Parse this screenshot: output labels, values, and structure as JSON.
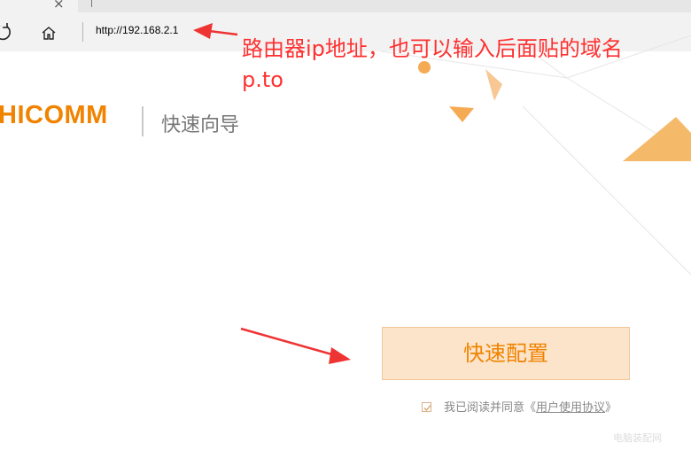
{
  "browser": {
    "address": "http://192.168.2.1",
    "refresh_icon": "refresh-icon",
    "home_icon": "home-icon",
    "close_icon": "close-icon"
  },
  "header": {
    "brand": "HICOMM",
    "wizard_title": "快速向导"
  },
  "annotation": {
    "line1": "路由器ip地址，也可以输入后面贴的域名",
    "line2": "p.to",
    "color": "#ff3030"
  },
  "main": {
    "quick_setup_label": "快速配置",
    "agreement_prefix": "我已阅读并同意《",
    "agreement_link": "用户使用协议",
    "agreement_suffix": "》",
    "agreement_checked": true
  },
  "watermark": "电脑装配网",
  "colors": {
    "brand": "#f08300",
    "button_bg": "#fce4cb",
    "button_text": "#ef8400",
    "decor_orange": "#f5b96a"
  }
}
